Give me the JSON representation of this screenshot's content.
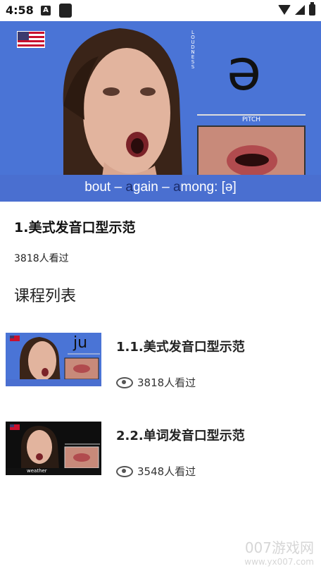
{
  "status_bar": {
    "time": "4:58",
    "a_icon": "A"
  },
  "hero": {
    "loudness_label": "LOUDNESS",
    "symbol": "ə",
    "pitch_label": "PITCH",
    "caption_parts": [
      "bout – ",
      "a",
      "gain – ",
      "a",
      "mong: [ə]"
    ]
  },
  "lesson": {
    "title": "1.美式发音口型示范",
    "views": "3818人看过"
  },
  "section_title": "课程列表",
  "courses": [
    {
      "title": "1.1.美式发音口型示范",
      "views": "3818人看过",
      "thumb_symbol": "ju"
    },
    {
      "title": "2.2.单词发音口型示范",
      "views": "3548人看过",
      "thumb_word": "weather"
    }
  ],
  "watermark": {
    "line1": "007游戏网",
    "line2": "www.yx007.com"
  }
}
